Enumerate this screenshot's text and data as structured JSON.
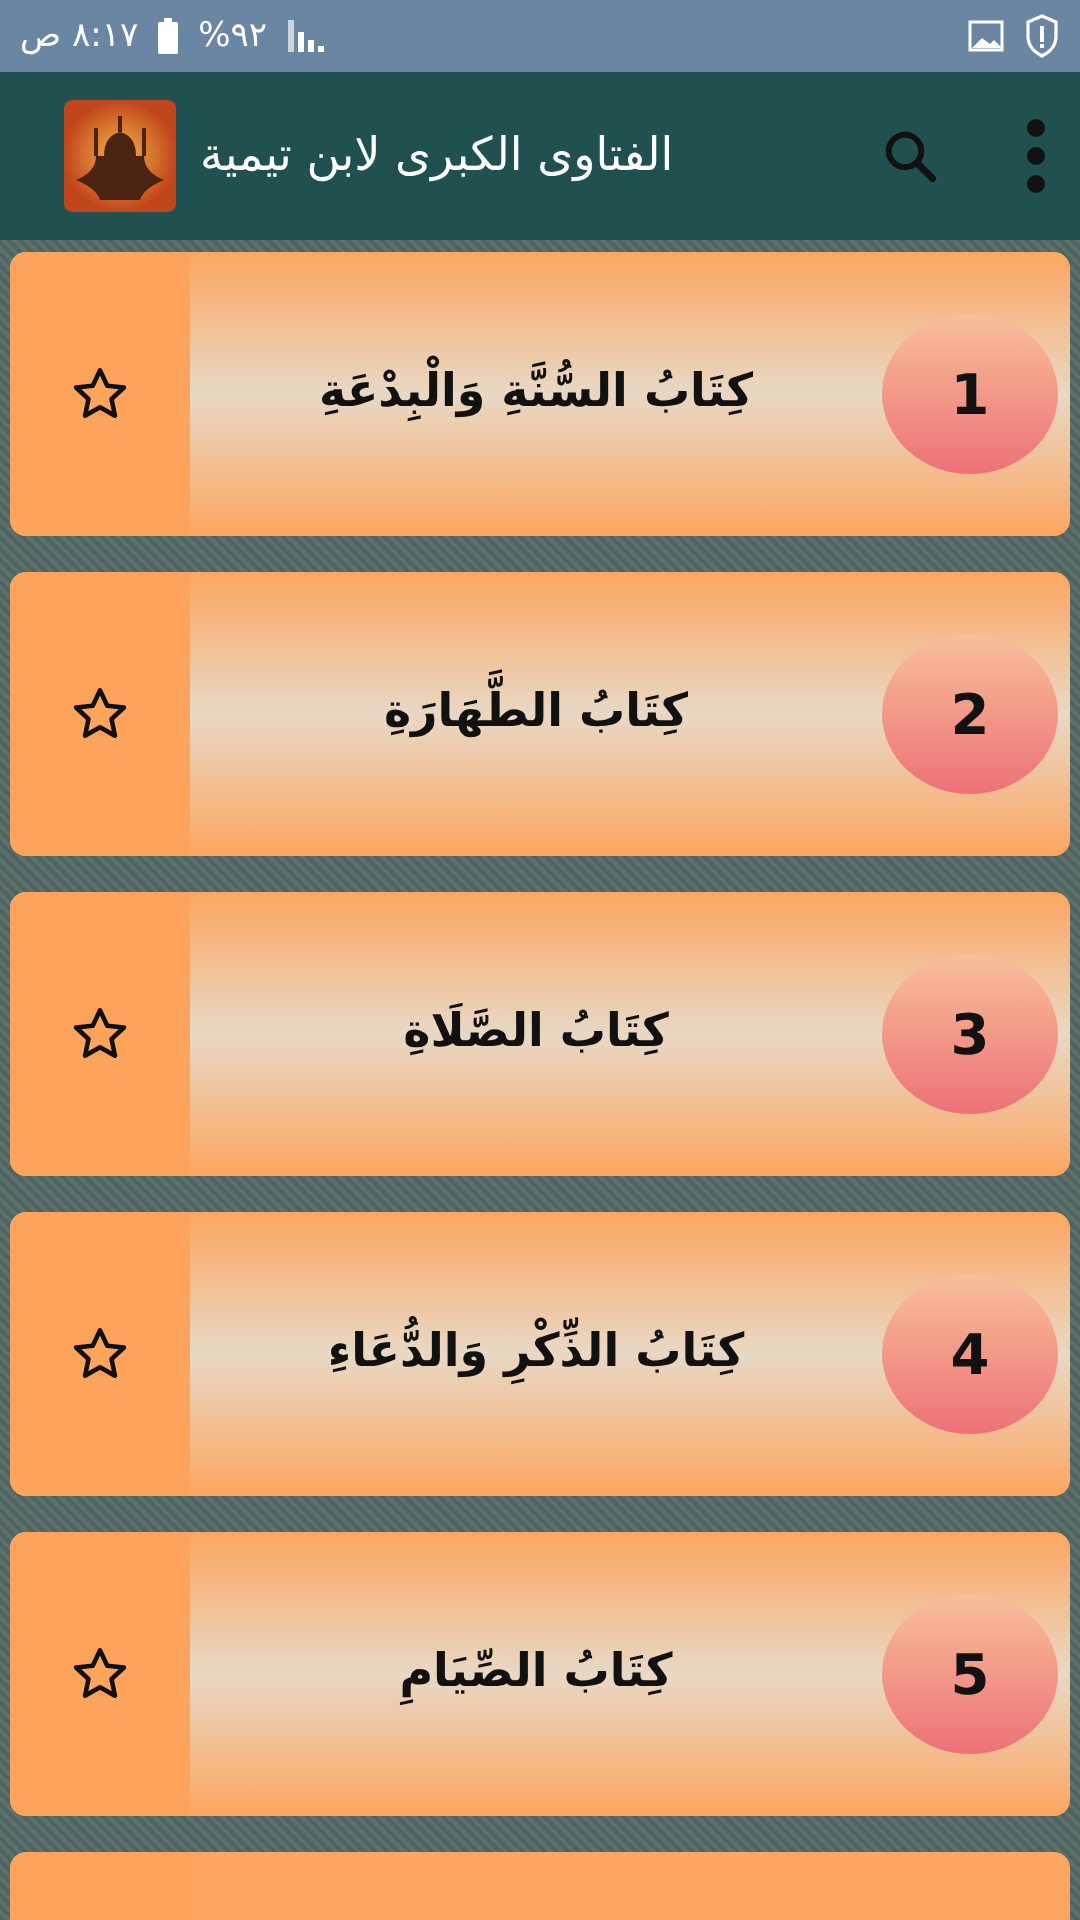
{
  "status_bar": {
    "time": "٨:١٧ ص",
    "battery": "%٩٢"
  },
  "toolbar": {
    "title": "الفتاوى الكبرى لابن تيمية"
  },
  "books": [
    {
      "number": "1",
      "title": "كِتَابُ السُّنَّةِ وَالْبِدْعَةِ",
      "starred": false
    },
    {
      "number": "2",
      "title": "كِتَابُ الطَّهَارَةِ",
      "starred": false
    },
    {
      "number": "3",
      "title": "كِتَابُ الصَّلَاةِ",
      "starred": false
    },
    {
      "number": "4",
      "title": "كِتَابُ الذِّكْرِ وَالدُّعَاءِ",
      "starred": false
    },
    {
      "number": "5",
      "title": "كِتَابُ الصِّيَامِ",
      "starred": false
    }
  ]
}
